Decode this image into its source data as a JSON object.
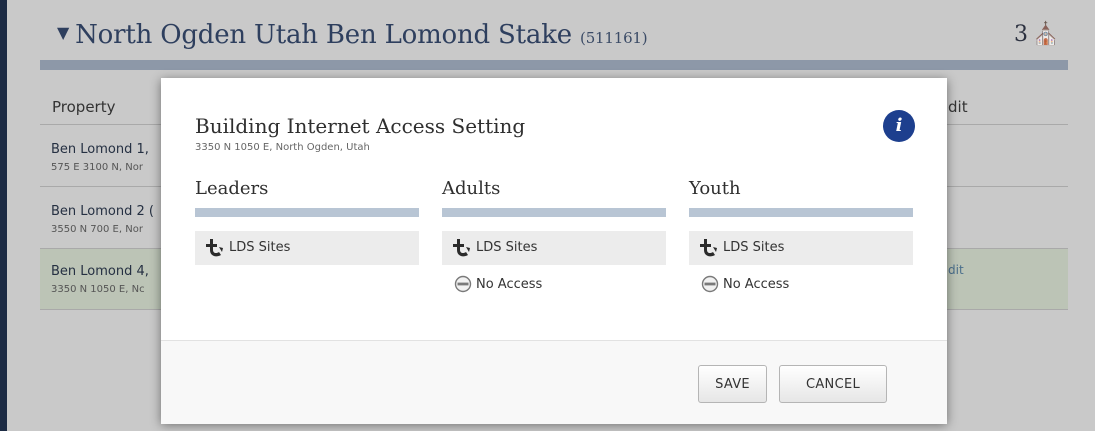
{
  "stake": {
    "name": "North Ogden Utah Ben Lomond Stake",
    "unit_code": "(511161)",
    "building_count": "3"
  },
  "table": {
    "col_property": "Property",
    "col_edit": "dit",
    "rows": [
      {
        "name": "Ben Lomond 1,",
        "address": "575 E 3100 N, Nor"
      },
      {
        "name": "Ben Lomond 2 (",
        "address": "3550 N 700 E, Nor"
      },
      {
        "name": "Ben Lomond 4,",
        "address": "3350 N 1050 E, Nc"
      }
    ],
    "edit_link": "dit"
  },
  "modal": {
    "title": "Building Internet Access Setting",
    "address": "3350 N 1050 E, North Ogden, Utah",
    "info_label": "i",
    "columns": [
      {
        "name": "Leaders",
        "options": [
          {
            "label": "LDS Sites",
            "icon": "lds-sites-icon",
            "selected": true
          }
        ]
      },
      {
        "name": "Adults",
        "options": [
          {
            "label": "LDS Sites",
            "icon": "lds-sites-icon",
            "selected": true
          },
          {
            "label": "No Access",
            "icon": "no-access-icon",
            "selected": false
          }
        ]
      },
      {
        "name": "Youth",
        "options": [
          {
            "label": "LDS Sites",
            "icon": "lds-sites-icon",
            "selected": true
          },
          {
            "label": "No Access",
            "icon": "no-access-icon",
            "selected": false
          }
        ]
      }
    ],
    "save_label": "SAVE",
    "cancel_label": "CANCEL"
  },
  "colors": {
    "info_badge": "#1d3f8e",
    "column_bar": "#b8c5d4",
    "selected_option_bg": "#ececec",
    "sidebar": "#1c2b44"
  }
}
